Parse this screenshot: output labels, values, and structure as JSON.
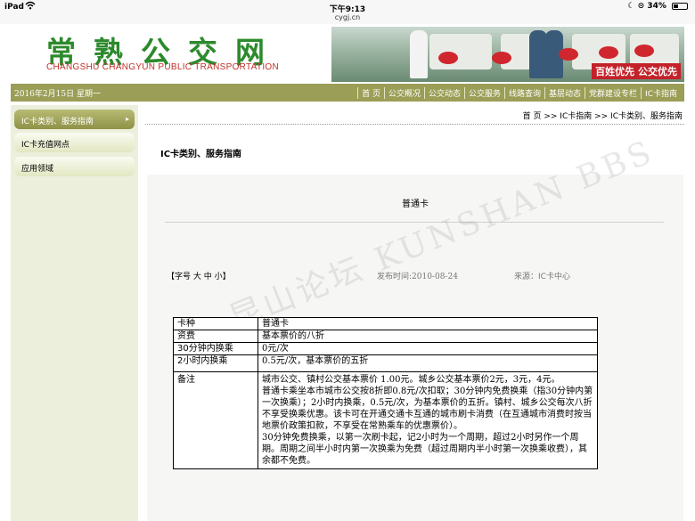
{
  "status_bar": {
    "device": "iPad",
    "time": "下午9:13",
    "url": "cygj.cn",
    "battery": "34%",
    "battery_level": 0.34
  },
  "header": {
    "logo_cn": "常熟公交网",
    "logo_en": "CHANGSHU CHANGYUN PUBLIC TRANSPORTATION",
    "slogan": "百姓优先 公交优先"
  },
  "nav": {
    "date": "2016年2月15日 星期一",
    "links": [
      "首 页",
      "公交概况",
      "公交动态",
      "公交服务",
      "线路查询",
      "基层动态",
      "党群建设专栏",
      "IC卡指南"
    ]
  },
  "sidebar": {
    "items": [
      {
        "label": "IC卡类别、服务指南",
        "active": true
      },
      {
        "label": "IC卡充值网点",
        "active": false
      },
      {
        "label": "应用领域",
        "active": false
      }
    ]
  },
  "breadcrumb": "首 页 >> IC卡指南 >> IC卡类别、服务指南",
  "page_title": "IC卡类别、服务指南",
  "article": {
    "title": "普通卡",
    "font_size_ctrl": "【字号 大 中 小】",
    "publish_time": "发布时间:2010-08-24",
    "source": "来源：IC卡中心",
    "watermark": "昆山论坛 KUNSHAN BBS",
    "table": [
      {
        "key": "卡种",
        "value": "普通卡"
      },
      {
        "key": "资费",
        "value": "基本票价的八折"
      },
      {
        "key": "30分钟内换乘",
        "value": "0元/次"
      },
      {
        "key": "2小时内换乘",
        "value": "0.5元/次，基本票价的五折"
      }
    ],
    "remark_key": "备注",
    "remark_lines": [
      "城市公交、镇村公交基本票价 1.00元。城乡公交基本票价2元，3元，4元。",
      "普通卡乘坐本市城市公交按8折即0.8元/次扣取；30分钟内免费换乘（指30分钟内第一次换乘）；2小时内换乘，0.5元/次，为基本票价的五折。镇村、城乡公交每次八折不享受换乘优惠。该卡可在开通交通卡互通的城市刷卡消费（在互通城市消费时按当地票价政策扣款，不享受在常熟乘车的优惠票价）。",
      "30分钟免费换乘，以第一次刷卡起，记2小时为一个周期，超过2小时另作一个周期。周期之间半小时内第一次换乘为免费（超过周期内半小时第一次换乘收费），其余都不免费。"
    ]
  }
}
